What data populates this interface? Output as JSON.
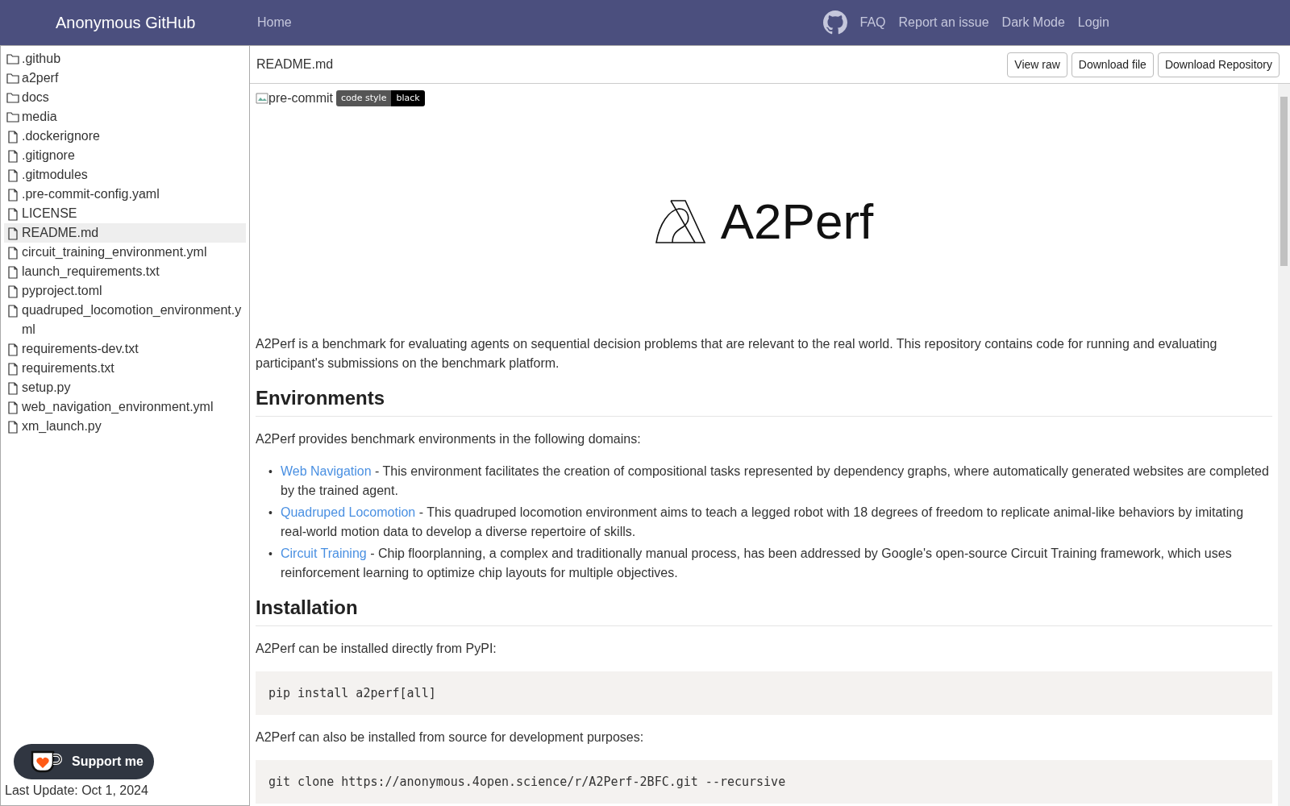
{
  "header": {
    "brand": "Anonymous GitHub",
    "nav_left": [
      "Home"
    ],
    "nav_right": [
      "FAQ",
      "Report an issue",
      "Dark Mode",
      "Login"
    ]
  },
  "sidebar": {
    "items": [
      {
        "name": ".github",
        "kind": "folder",
        "selected": false
      },
      {
        "name": "a2perf",
        "kind": "folder",
        "selected": false
      },
      {
        "name": "docs",
        "kind": "folder",
        "selected": false
      },
      {
        "name": "media",
        "kind": "folder",
        "selected": false
      },
      {
        "name": ".dockerignore",
        "kind": "file",
        "selected": false
      },
      {
        "name": ".gitignore",
        "kind": "file",
        "selected": false
      },
      {
        "name": ".gitmodules",
        "kind": "file",
        "selected": false
      },
      {
        "name": ".pre-commit-config.yaml",
        "kind": "file",
        "selected": false
      },
      {
        "name": "LICENSE",
        "kind": "file",
        "selected": false
      },
      {
        "name": "README.md",
        "kind": "file",
        "selected": true
      },
      {
        "name": "circuit_training_environment.yml",
        "kind": "file",
        "selected": false
      },
      {
        "name": "launch_requirements.txt",
        "kind": "file",
        "selected": false
      },
      {
        "name": "pyproject.toml",
        "kind": "file",
        "selected": false
      },
      {
        "name": "quadruped_locomotion_environment.yml",
        "kind": "file",
        "selected": false
      },
      {
        "name": "requirements-dev.txt",
        "kind": "file",
        "selected": false
      },
      {
        "name": "requirements.txt",
        "kind": "file",
        "selected": false
      },
      {
        "name": "setup.py",
        "kind": "file",
        "selected": false
      },
      {
        "name": "web_navigation_environment.yml",
        "kind": "file",
        "selected": false
      },
      {
        "name": "xm_launch.py",
        "kind": "file",
        "selected": false
      }
    ],
    "last_update": "Last Update: Oct 1, 2024",
    "support_button": "Support me"
  },
  "file_bar": {
    "filename": "README.md",
    "buttons": [
      "View raw",
      "Download file",
      "Download Repository"
    ]
  },
  "readme": {
    "broken_image_alt": "pre-commit",
    "badge": {
      "label": "code style",
      "value": "black"
    },
    "logo_text": "A2Perf",
    "blocks": [
      {
        "kind": "paragraph",
        "text": "A2Perf is a benchmark for evaluating agents on sequential decision problems that are relevant to the real world. This repository contains code for running and evaluating participant's submissions on the benchmark platform."
      },
      {
        "kind": "heading",
        "text": "Environments"
      },
      {
        "kind": "paragraph",
        "text": "A2Perf provides benchmark environments in the following domains:"
      },
      {
        "kind": "list",
        "items": [
          {
            "marker": "•",
            "link": "Web Navigation",
            "text": " - This environment facilitates the creation of compositional tasks represented by dependency graphs, where automatically generated websites are completed by the trained agent."
          },
          {
            "marker": "•",
            "link": "Quadruped Locomotion",
            "text": " - This quadruped locomotion environment aims to teach a legged robot with 18 degrees of freedom to replicate animal-like behaviors by imitating real-world motion data to develop a diverse repertoire of skills."
          },
          {
            "marker": "•",
            "link": "Circuit Training",
            "text": " - Chip floorplanning, a complex and traditionally manual process, has been addressed by Google's open-source Circuit Training framework, which uses reinforcement learning to optimize chip layouts for multiple objectives."
          }
        ]
      },
      {
        "kind": "heading",
        "text": "Installation"
      },
      {
        "kind": "paragraph",
        "text": "A2Perf can be installed directly from PyPI:"
      },
      {
        "kind": "code",
        "text": "pip install a2perf[all]"
      },
      {
        "kind": "paragraph",
        "text": "A2Perf can also be installed from source for development purposes:"
      },
      {
        "kind": "code",
        "text": "git clone https://anonymous.4open.science/r/A2Perf-2BFC.git --recursive"
      }
    ]
  }
}
